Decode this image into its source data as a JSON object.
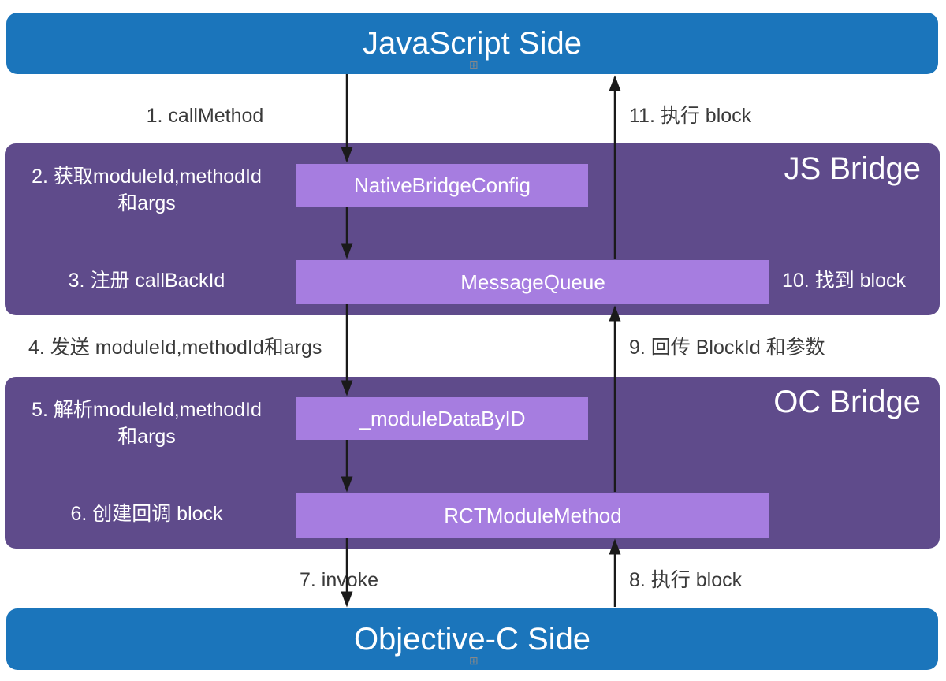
{
  "top": {
    "title": "JavaScript Side"
  },
  "bottom": {
    "title": "Objective-C Side"
  },
  "bridges": {
    "js": {
      "title": "JS Bridge",
      "box1": "NativeBridgeConfig",
      "box2": "MessageQueue"
    },
    "oc": {
      "title": "OC Bridge",
      "box1": "_moduleDataByID",
      "box2": "RCTModuleMethod"
    }
  },
  "steps": {
    "s1": "1. callMethod",
    "s2a": "2. 获取moduleId,methodId",
    "s2b": "和args",
    "s3": "3. 注册 callBackId",
    "s4": "4. 发送 moduleId,methodId和args",
    "s5a": "5. 解析moduleId,methodId",
    "s5b": "和args",
    "s6": "6. 创建回调 block",
    "s7": "7. invoke",
    "s8": "8. 执行 block",
    "s9": "9. 回传 BlockId 和参数",
    "s10": "10. 找到 block",
    "s11": "11. 执行 block"
  },
  "colors": {
    "blue": "#1b75bb",
    "darkPurple": "#5F4B8B",
    "lightPurple": "#a67de0"
  }
}
